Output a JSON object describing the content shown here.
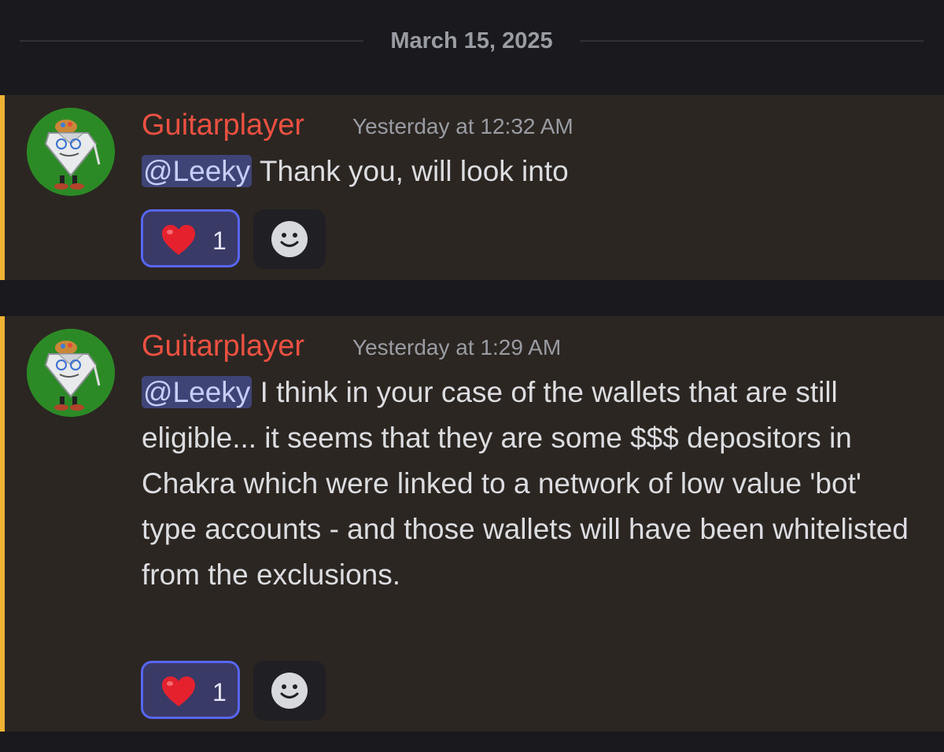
{
  "divider": {
    "date": "March 15, 2025"
  },
  "messages": [
    {
      "author": "Guitarplayer",
      "timestamp": "Yesterday at 12:32 AM",
      "mention": "@Leeky",
      "text": " Thank you, will look into",
      "reactions": [
        {
          "emoji": "heart-emoji",
          "count": "1"
        }
      ],
      "add_reaction_icon": "smile-icon"
    },
    {
      "author": "Guitarplayer",
      "timestamp": "Yesterday at 1:29 AM",
      "mention": "@Leeky",
      "text": " I think in your case of the wallets that are still eligible... it seems that they are some $$$ depositors in Chakra which were linked to a network of low value 'bot' type accounts - and those wallets will have been whitelisted from the exclusions.",
      "reactions": [
        {
          "emoji": "heart-emoji",
          "count": "1"
        }
      ],
      "add_reaction_icon": "smile-icon"
    }
  ],
  "colors": {
    "background": "#1a1a1e",
    "highlight_message": "#2b2622",
    "highlight_bar": "#f0b232",
    "username": "#ec5142",
    "mention_bg": "#3f4477",
    "reaction_border": "#5865f2"
  }
}
